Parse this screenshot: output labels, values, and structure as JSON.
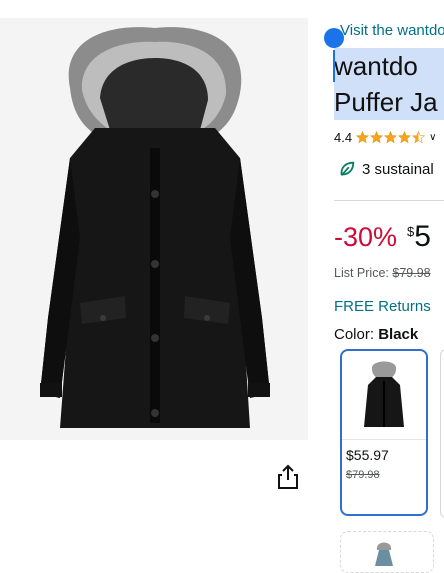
{
  "brand_link": "Visit the wantdo",
  "title": {
    "line1": "wantdo",
    "line2": "Puffer Ja"
  },
  "rating": {
    "value": "4.4",
    "stars": 4.4,
    "star_color": "#f7a41d"
  },
  "sustainability": {
    "text": "3 sustainal",
    "icon": "leaf-icon",
    "color": "#067d62"
  },
  "pricing": {
    "discount": "-30%",
    "currency": "$",
    "price": "5",
    "list_price_label": "List Price:",
    "list_price_value": "$79.98",
    "discount_color": "#cc0c39"
  },
  "returns": "FREE Returns",
  "color": {
    "label": "Color:",
    "value": "Black"
  },
  "swatches": [
    {
      "price": "$55.97",
      "list_price": "$79.98",
      "selected": true
    }
  ],
  "icons": {
    "share": "share-icon",
    "selection_handle": "selection-handle"
  },
  "colors": {
    "link": "#007185",
    "selection": "#1a73e8",
    "selected_border": "#2e6fcf"
  }
}
